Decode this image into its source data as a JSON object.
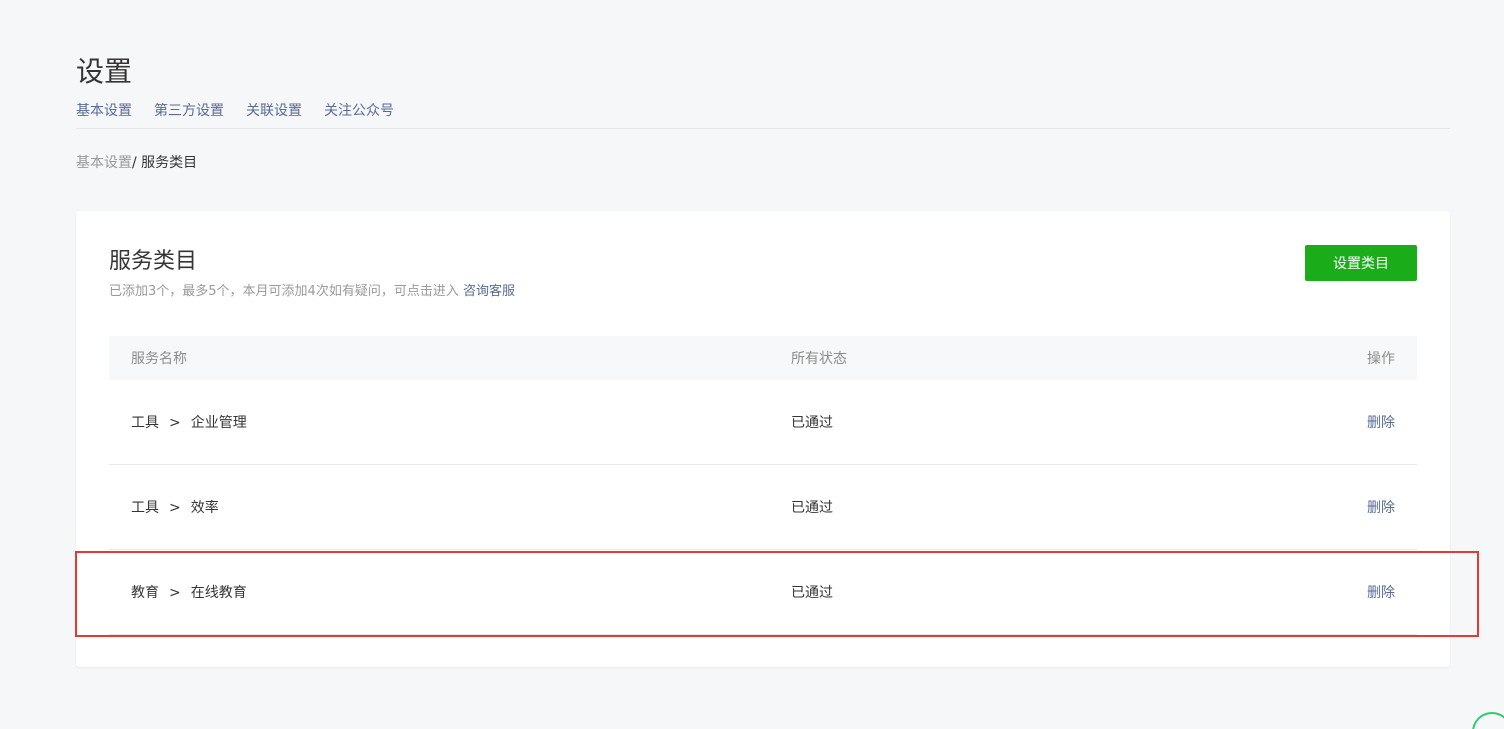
{
  "page": {
    "title": "设置"
  },
  "tabs": [
    {
      "label": "基本设置"
    },
    {
      "label": "第三方设置"
    },
    {
      "label": "关联设置"
    },
    {
      "label": "关注公众号"
    }
  ],
  "breadcrumb": {
    "parent": "基本设置",
    "separator": "/ ",
    "current": "服务类目"
  },
  "section": {
    "title": "服务类目",
    "description": "已添加3个，最多5个，本月可添加4次如有疑问，可点击进入 ",
    "link_label": "咨询客服",
    "action_label": "设置类目"
  },
  "table": {
    "headers": {
      "name": "服务名称",
      "status": "所有状态",
      "action": "操作"
    },
    "rows": [
      {
        "category": "工具",
        "arrow": ">",
        "subcategory": "企业管理",
        "status": "已通过",
        "action": "删除"
      },
      {
        "category": "工具",
        "arrow": ">",
        "subcategory": "效率",
        "status": "已通过",
        "action": "删除"
      },
      {
        "category": "教育",
        "arrow": ">",
        "subcategory": "在线教育",
        "status": "已通过",
        "action": "删除"
      }
    ]
  },
  "colors": {
    "primary_green": "#1aad19",
    "link_blue": "#576b95",
    "highlight_red": "#e53935"
  }
}
